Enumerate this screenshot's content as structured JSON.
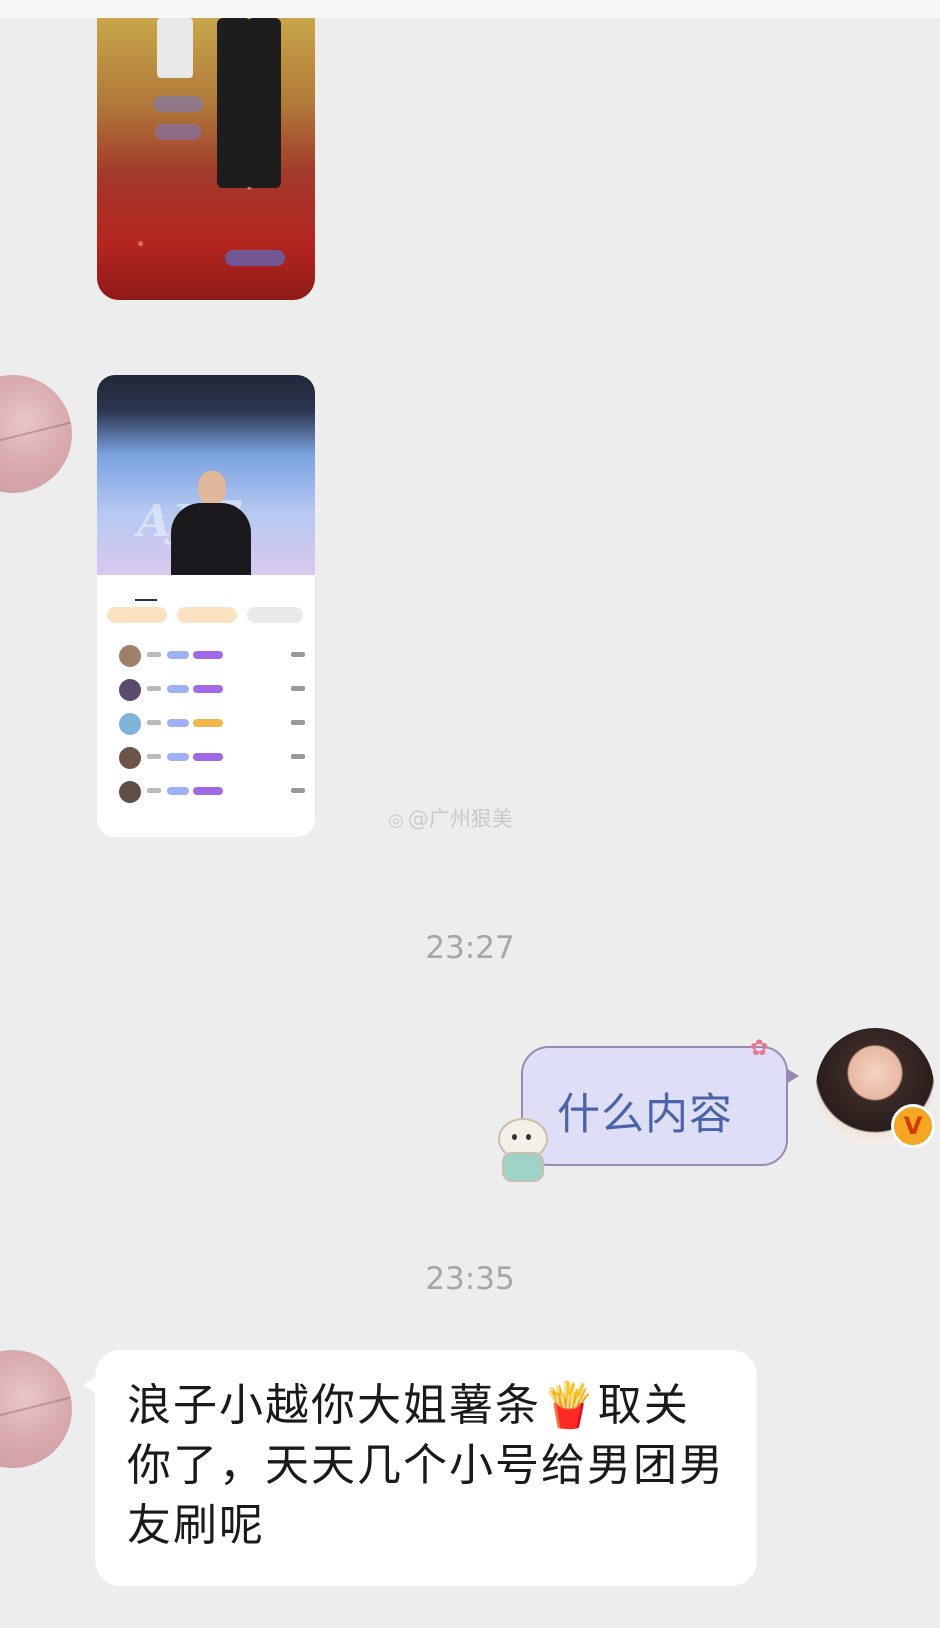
{
  "chat": {
    "watermark": "@广州狠美",
    "timestamps": [
      "23:27",
      "23:35"
    ],
    "outgoing_message": "什么内容",
    "incoming_message": "浪子小越你大姐薯条🍟取关你了，天天几个小号给男团男友刷呢",
    "sender_badge": "V",
    "thumbnail2": {
      "banner": "AJ团"
    }
  },
  "colors": {
    "background": "#ededed",
    "outgoing_bubble": "#dedff6",
    "outgoing_text": "#4b63a8",
    "incoming_bubble": "#ffffff",
    "timestamp": "#a6a6a6",
    "badge": "#f5a623"
  },
  "icons": {
    "watermark": "weibo-icon",
    "fries": "fries-emoji",
    "verified": "verified-badge"
  }
}
